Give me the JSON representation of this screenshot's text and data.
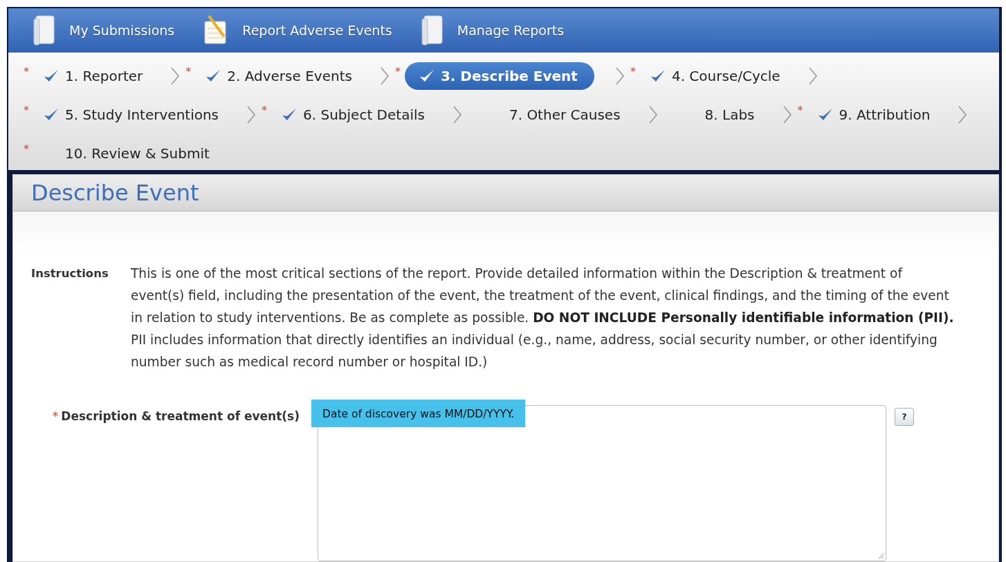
{
  "top_nav": [
    {
      "label": "My Submissions",
      "kind": "binder"
    },
    {
      "label": "Report Adverse Events",
      "kind": "notepad"
    },
    {
      "label": "Manage Reports",
      "kind": "binder"
    }
  ],
  "steps": [
    {
      "required_mark": "*",
      "label": "1. Reporter",
      "completed": true,
      "selected": false
    },
    {
      "required_mark": "*",
      "label": "2. Adverse Events",
      "completed": true,
      "selected": false
    },
    {
      "required_mark": "*",
      "label": "3. Describe Event",
      "completed": true,
      "selected": true
    },
    {
      "required_mark": "*",
      "label": "4. Course/Cycle",
      "completed": true,
      "selected": false
    },
    {
      "required_mark": "*",
      "label": "5. Study Interventions",
      "completed": true,
      "selected": false
    },
    {
      "required_mark": "*",
      "label": "6. Subject Details",
      "completed": true,
      "selected": false
    },
    {
      "label": "7. Other Causes",
      "completed": false,
      "selected": false
    },
    {
      "label": "8. Labs",
      "completed": false,
      "selected": false
    },
    {
      "required_mark": "*",
      "label": "9. Attribution",
      "completed": true,
      "selected": false
    },
    {
      "required_mark": "*",
      "label": "10. Review & Submit",
      "completed": false,
      "selected": false
    }
  ],
  "section": {
    "title": "Describe Event",
    "instructions_label": "Instructions",
    "instructions": "This is one of the most critical sections of the report. Provide detailed information within the Description & treatment of event(s) field, including the presentation of the event, the treatment of the event, clinical findings, and the timing of the event in relation to study interventions. Be as complete as possible. **DO NOT INCLUDE Personally identifiable information (PII).** PII includes information that directly identifies an individual (e.g., name, address, social security number, or other identifying number such as medical record number or hospital ID.)",
    "field": {
      "required_mark": "*",
      "label": "Description & treatment of event(s)",
      "callout": "Date of discovery was MM/DD/YYYY.",
      "help": "?"
    }
  }
}
